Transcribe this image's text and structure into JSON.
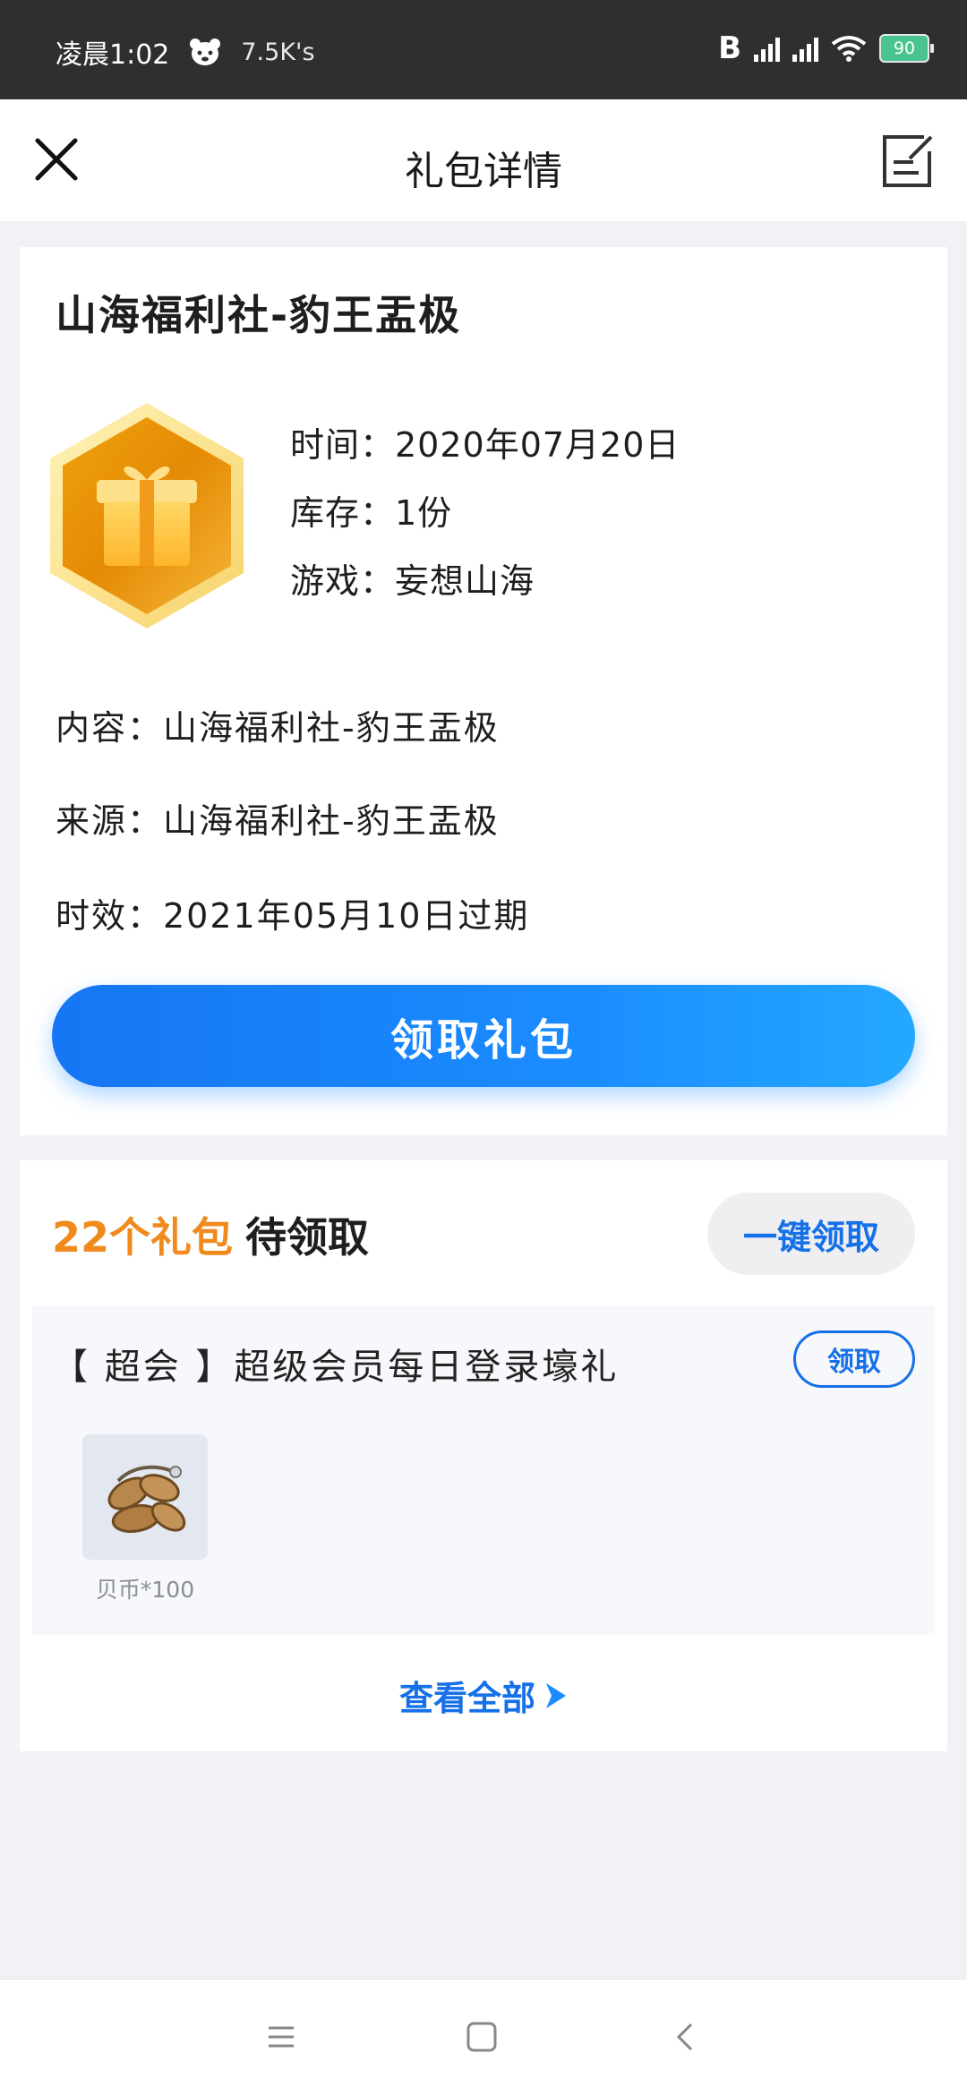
{
  "status_bar": {
    "time": "凌晨1:02",
    "speed": "7.5K's",
    "bt": "B",
    "signal_label": "ıll",
    "battery": "90"
  },
  "header": {
    "title": "礼包详情",
    "close_icon": "close-icon",
    "edit_icon": "edit-note-icon"
  },
  "gift": {
    "title": "山海福利社-豹王盂极",
    "time": "时间：2020年07月20日",
    "stock": "库存：1份",
    "game": "游戏：妄想山海",
    "content": "内容：山海福利社-豹王盂极",
    "source": "来源：山海福利社-豹王盂极",
    "expiry": "时效：2021年05月10日过期",
    "claim_label": "领取礼包"
  },
  "pending": {
    "count_label": "22个礼包",
    "rest_label": "待领取",
    "oneclick_label": "一键领取",
    "item": {
      "title": "【 超会 】超级会员每日登录壕礼",
      "claim_label": "领取",
      "reward_label": "贝币*100"
    },
    "view_all": "查看全部"
  },
  "colors": {
    "accent": "#1670e8",
    "orange": "#f08a1c",
    "status_bg": "#2e2f31"
  }
}
